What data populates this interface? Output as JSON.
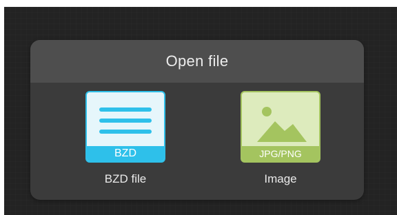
{
  "dialog": {
    "title": "Open file",
    "options": [
      {
        "icon": "document-lines-icon",
        "icon_tag": "BZD",
        "label": "BZD file",
        "accent_color": "#2ec0ea"
      },
      {
        "icon": "image-icon",
        "icon_tag": "JPG/PNG",
        "label": "Image",
        "accent_color": "#a4c45f"
      }
    ]
  }
}
